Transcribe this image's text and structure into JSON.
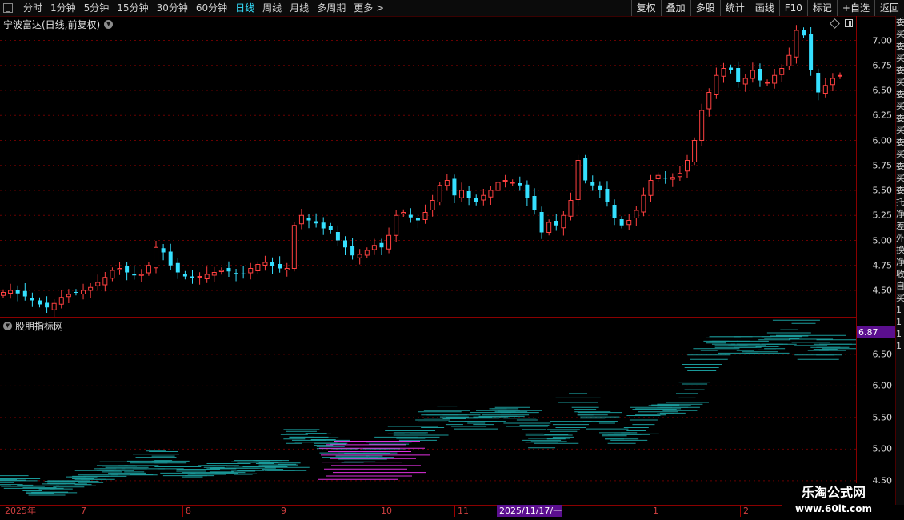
{
  "toolbar": {
    "periods": [
      "分时",
      "1分钟",
      "5分钟",
      "15分钟",
      "30分钟",
      "60分钟",
      "日线",
      "周线",
      "月线",
      "多周期",
      "更多 >"
    ],
    "active_period": "日线",
    "tools": [
      "复权",
      "叠加",
      "多股",
      "统计",
      "画线",
      "F10",
      "标记",
      "+自选",
      "返回"
    ]
  },
  "price_panel": {
    "title": "宁波富达(日线,前复权)",
    "y_ticks": [
      "7.00",
      "6.75",
      "6.50",
      "6.25",
      "6.00",
      "5.75",
      "5.50",
      "5.25",
      "5.00",
      "4.75",
      "4.50"
    ]
  },
  "indicator_panel": {
    "title": "股朋指标网",
    "marker_value": "6.87",
    "y_ticks": [
      "6.50",
      "6.00",
      "5.50",
      "5.00",
      "4.50"
    ]
  },
  "date_axis": {
    "labels": [
      "2025年",
      "7",
      "8",
      "9",
      "10",
      "11",
      "2025/11/17/一",
      "1",
      "2"
    ],
    "highlight": "2025/11/17/一"
  },
  "right_strip_text": "委买委买委买委买委买委买委买委托净差外换净收自买1111",
  "watermark": {
    "line1": "乐淘公式网",
    "line2": "www.60lt.com"
  },
  "colors": {
    "up": "#ff4040",
    "down": "#35e0ff",
    "grid": "#6a0000",
    "teal": "#1a9a9a",
    "magenta": "#e030e0"
  },
  "chart_data": {
    "type": "candlestick",
    "approx_closes": [
      4.48,
      4.5,
      4.47,
      4.44,
      4.4,
      4.36,
      4.33,
      4.37,
      4.43,
      4.46,
      4.48,
      4.5,
      4.53,
      4.58,
      4.63,
      4.7,
      4.72,
      4.68,
      4.65,
      4.66,
      4.75,
      4.93,
      4.88,
      4.75,
      4.68,
      4.64,
      4.62,
      4.64,
      4.66,
      4.68,
      4.7,
      4.69,
      4.67,
      4.66,
      4.72,
      4.76,
      4.78,
      4.74,
      4.72,
      4.72,
      5.15,
      5.25,
      5.2,
      5.17,
      5.12,
      5.1,
      5.0,
      4.93,
      4.85,
      4.86,
      4.9,
      4.95,
      4.93,
      5.05,
      5.25,
      5.28,
      5.23,
      5.2,
      5.28,
      5.4,
      5.55,
      5.6,
      5.45,
      5.5,
      5.42,
      5.38,
      5.45,
      5.5,
      5.58,
      5.6,
      5.58,
      5.55,
      5.42,
      5.3,
      5.08,
      5.18,
      5.15,
      5.25,
      5.4,
      5.8,
      5.6,
      5.55,
      5.5,
      5.38,
      5.22,
      5.15,
      5.2,
      5.3,
      5.45,
      5.6,
      5.65,
      5.62,
      5.63,
      5.67,
      5.8,
      6.0,
      6.3,
      6.48,
      6.65,
      6.72,
      6.7,
      6.58,
      6.62,
      6.7,
      6.6,
      6.58,
      6.65,
      6.72,
      6.85,
      7.1,
      7.05,
      6.7,
      6.48,
      6.55,
      6.62,
      6.65
    ],
    "y_range": [
      4.3,
      7.18
    ],
    "indicator_y_range": [
      4.22,
      6.98
    ]
  }
}
